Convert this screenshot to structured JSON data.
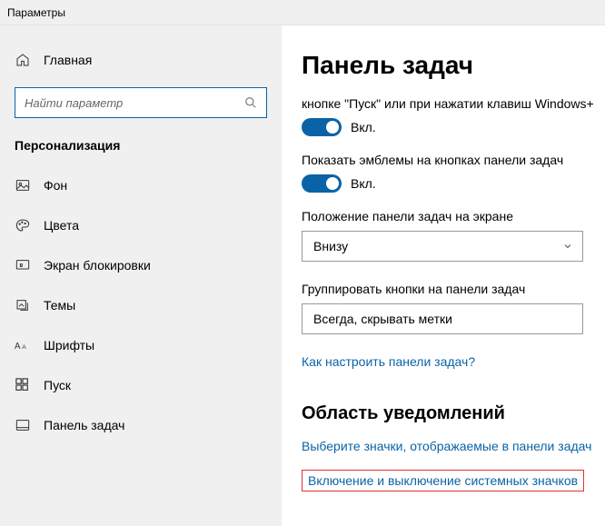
{
  "titlebar": {
    "title": "Параметры"
  },
  "sidebar": {
    "home_label": "Главная",
    "search_placeholder": "Найти параметр",
    "category_title": "Персонализация",
    "items": [
      {
        "label": "Фон"
      },
      {
        "label": "Цвета"
      },
      {
        "label": "Экран блокировки"
      },
      {
        "label": "Темы"
      },
      {
        "label": "Шрифты"
      },
      {
        "label": "Пуск"
      },
      {
        "label": "Панель задач"
      }
    ]
  },
  "main": {
    "heading": "Панель задач",
    "setting1": {
      "text": "кнопке \"Пуск\" или при нажатии клавиш Windows+",
      "state_label": "Вкл."
    },
    "setting2": {
      "text": "Показать эмблемы на кнопках панели задач",
      "state_label": "Вкл."
    },
    "position": {
      "label": "Положение панели задач на экране",
      "value": "Внизу"
    },
    "grouping": {
      "label": "Группировать кнопки на панели задач",
      "value": "Всегда, скрывать метки"
    },
    "link_configure": "Как настроить панели задач?",
    "notification_heading": "Область уведомлений",
    "link_select_icons": "Выберите значки, отображаемые в панели задач",
    "link_system_icons": "Включение и выключение системных значков"
  }
}
